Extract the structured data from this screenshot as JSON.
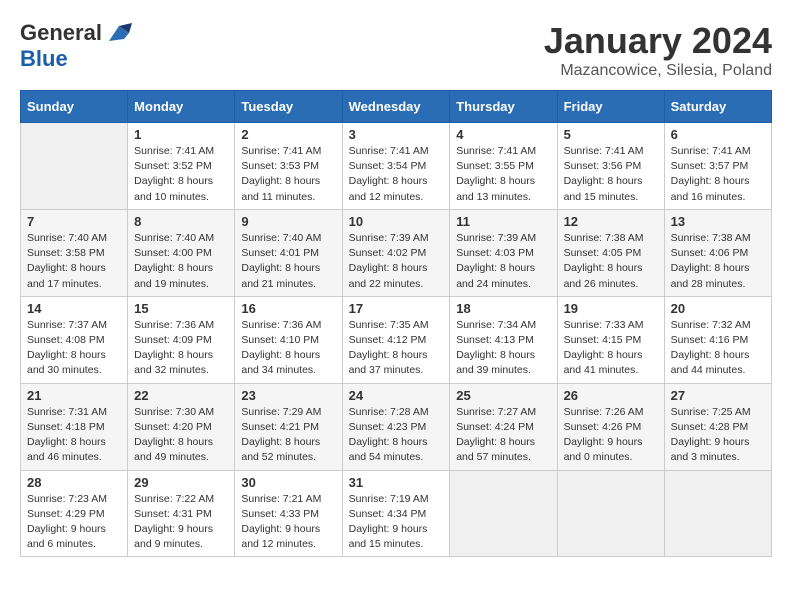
{
  "logo": {
    "general": "General",
    "blue": "Blue"
  },
  "title": "January 2024",
  "location": "Mazancowice, Silesia, Poland",
  "days_header": [
    "Sunday",
    "Monday",
    "Tuesday",
    "Wednesday",
    "Thursday",
    "Friday",
    "Saturday"
  ],
  "weeks": [
    [
      {
        "day": "",
        "info": ""
      },
      {
        "day": "1",
        "info": "Sunrise: 7:41 AM\nSunset: 3:52 PM\nDaylight: 8 hours\nand 10 minutes."
      },
      {
        "day": "2",
        "info": "Sunrise: 7:41 AM\nSunset: 3:53 PM\nDaylight: 8 hours\nand 11 minutes."
      },
      {
        "day": "3",
        "info": "Sunrise: 7:41 AM\nSunset: 3:54 PM\nDaylight: 8 hours\nand 12 minutes."
      },
      {
        "day": "4",
        "info": "Sunrise: 7:41 AM\nSunset: 3:55 PM\nDaylight: 8 hours\nand 13 minutes."
      },
      {
        "day": "5",
        "info": "Sunrise: 7:41 AM\nSunset: 3:56 PM\nDaylight: 8 hours\nand 15 minutes."
      },
      {
        "day": "6",
        "info": "Sunrise: 7:41 AM\nSunset: 3:57 PM\nDaylight: 8 hours\nand 16 minutes."
      }
    ],
    [
      {
        "day": "7",
        "info": "Sunrise: 7:40 AM\nSunset: 3:58 PM\nDaylight: 8 hours\nand 17 minutes."
      },
      {
        "day": "8",
        "info": "Sunrise: 7:40 AM\nSunset: 4:00 PM\nDaylight: 8 hours\nand 19 minutes."
      },
      {
        "day": "9",
        "info": "Sunrise: 7:40 AM\nSunset: 4:01 PM\nDaylight: 8 hours\nand 21 minutes."
      },
      {
        "day": "10",
        "info": "Sunrise: 7:39 AM\nSunset: 4:02 PM\nDaylight: 8 hours\nand 22 minutes."
      },
      {
        "day": "11",
        "info": "Sunrise: 7:39 AM\nSunset: 4:03 PM\nDaylight: 8 hours\nand 24 minutes."
      },
      {
        "day": "12",
        "info": "Sunrise: 7:38 AM\nSunset: 4:05 PM\nDaylight: 8 hours\nand 26 minutes."
      },
      {
        "day": "13",
        "info": "Sunrise: 7:38 AM\nSunset: 4:06 PM\nDaylight: 8 hours\nand 28 minutes."
      }
    ],
    [
      {
        "day": "14",
        "info": "Sunrise: 7:37 AM\nSunset: 4:08 PM\nDaylight: 8 hours\nand 30 minutes."
      },
      {
        "day": "15",
        "info": "Sunrise: 7:36 AM\nSunset: 4:09 PM\nDaylight: 8 hours\nand 32 minutes."
      },
      {
        "day": "16",
        "info": "Sunrise: 7:36 AM\nSunset: 4:10 PM\nDaylight: 8 hours\nand 34 minutes."
      },
      {
        "day": "17",
        "info": "Sunrise: 7:35 AM\nSunset: 4:12 PM\nDaylight: 8 hours\nand 37 minutes."
      },
      {
        "day": "18",
        "info": "Sunrise: 7:34 AM\nSunset: 4:13 PM\nDaylight: 8 hours\nand 39 minutes."
      },
      {
        "day": "19",
        "info": "Sunrise: 7:33 AM\nSunset: 4:15 PM\nDaylight: 8 hours\nand 41 minutes."
      },
      {
        "day": "20",
        "info": "Sunrise: 7:32 AM\nSunset: 4:16 PM\nDaylight: 8 hours\nand 44 minutes."
      }
    ],
    [
      {
        "day": "21",
        "info": "Sunrise: 7:31 AM\nSunset: 4:18 PM\nDaylight: 8 hours\nand 46 minutes."
      },
      {
        "day": "22",
        "info": "Sunrise: 7:30 AM\nSunset: 4:20 PM\nDaylight: 8 hours\nand 49 minutes."
      },
      {
        "day": "23",
        "info": "Sunrise: 7:29 AM\nSunset: 4:21 PM\nDaylight: 8 hours\nand 52 minutes."
      },
      {
        "day": "24",
        "info": "Sunrise: 7:28 AM\nSunset: 4:23 PM\nDaylight: 8 hours\nand 54 minutes."
      },
      {
        "day": "25",
        "info": "Sunrise: 7:27 AM\nSunset: 4:24 PM\nDaylight: 8 hours\nand 57 minutes."
      },
      {
        "day": "26",
        "info": "Sunrise: 7:26 AM\nSunset: 4:26 PM\nDaylight: 9 hours\nand 0 minutes."
      },
      {
        "day": "27",
        "info": "Sunrise: 7:25 AM\nSunset: 4:28 PM\nDaylight: 9 hours\nand 3 minutes."
      }
    ],
    [
      {
        "day": "28",
        "info": "Sunrise: 7:23 AM\nSunset: 4:29 PM\nDaylight: 9 hours\nand 6 minutes."
      },
      {
        "day": "29",
        "info": "Sunrise: 7:22 AM\nSunset: 4:31 PM\nDaylight: 9 hours\nand 9 minutes."
      },
      {
        "day": "30",
        "info": "Sunrise: 7:21 AM\nSunset: 4:33 PM\nDaylight: 9 hours\nand 12 minutes."
      },
      {
        "day": "31",
        "info": "Sunrise: 7:19 AM\nSunset: 4:34 PM\nDaylight: 9 hours\nand 15 minutes."
      },
      {
        "day": "",
        "info": ""
      },
      {
        "day": "",
        "info": ""
      },
      {
        "day": "",
        "info": ""
      }
    ]
  ]
}
